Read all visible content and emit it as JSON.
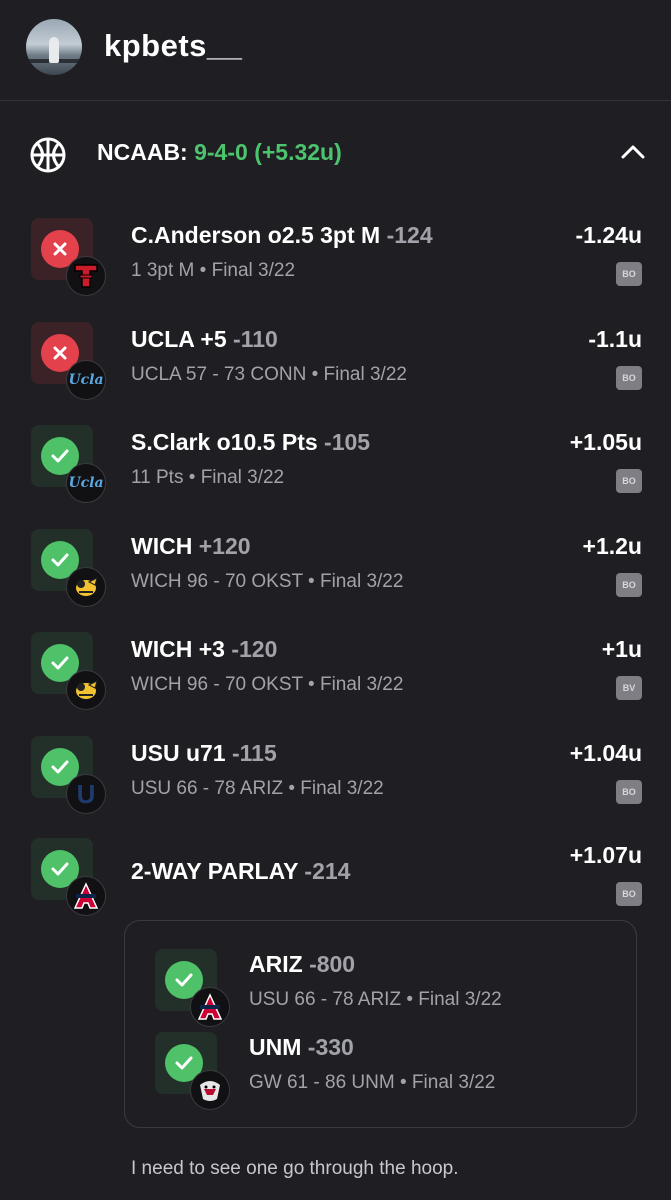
{
  "header": {
    "username": "kpbets__"
  },
  "league": {
    "label": "NCAAB:",
    "record": "9-4-0 (+5.32u)",
    "icon": "basketball-icon",
    "toggle_icon": "chevron-up-icon"
  },
  "bets": [
    {
      "name": "C.Anderson o2.5 3pt M",
      "odds": "-124",
      "result": "1 3pt M",
      "status_text": "Final 3/22",
      "units": "-1.24u",
      "badge": "BO",
      "outcome": "loss",
      "team_logo": "texas-tech"
    },
    {
      "name": "UCLA +5",
      "odds": "-110",
      "result": "UCLA 57 - 73 CONN",
      "status_text": "Final 3/22",
      "units": "-1.1u",
      "badge": "BO",
      "outcome": "loss",
      "team_logo": "ucla"
    },
    {
      "name": "S.Clark o10.5 Pts",
      "odds": "-105",
      "result": "11 Pts",
      "status_text": "Final 3/22",
      "units": "+1.05u",
      "badge": "BO",
      "outcome": "win",
      "team_logo": "ucla"
    },
    {
      "name": "WICH",
      "odds": "+120",
      "result": "WICH 96 - 70 OKST",
      "status_text": "Final 3/22",
      "units": "+1.2u",
      "badge": "BO",
      "outcome": "win",
      "team_logo": "wichita-state"
    },
    {
      "name": "WICH +3",
      "odds": "-120",
      "result": "WICH 96 - 70 OKST",
      "status_text": "Final 3/22",
      "units": "+1u",
      "badge": "BV",
      "outcome": "win",
      "team_logo": "wichita-state"
    },
    {
      "name": "USU u71",
      "odds": "-115",
      "result": "USU 66 - 78 ARIZ",
      "status_text": "Final 3/22",
      "units": "+1.04u",
      "badge": "BO",
      "outcome": "win",
      "team_logo": "utah-state"
    }
  ],
  "parlay": {
    "name": "2-WAY PARLAY",
    "odds": "-214",
    "units": "+1.07u",
    "badge": "BO",
    "outcome": "win",
    "team_logo": "arizona",
    "legs": [
      {
        "name": "ARIZ",
        "odds": "-800",
        "result": "USU 66 - 78 ARIZ",
        "status_text": "Final 3/22",
        "outcome": "win",
        "team_logo": "arizona"
      },
      {
        "name": "UNM",
        "odds": "-330",
        "result": "GW 61 - 86 UNM",
        "status_text": "Final 3/22",
        "outcome": "win",
        "team_logo": "new-mexico"
      }
    ]
  },
  "separator": "•",
  "comment": "I need to see one go through the hoop.",
  "colors": {
    "background": "#1f1f23",
    "win_green": "#4fc269",
    "loss_red": "#e3414c",
    "muted_text": "#a2a2aa",
    "record_green": "#4cc46e"
  }
}
